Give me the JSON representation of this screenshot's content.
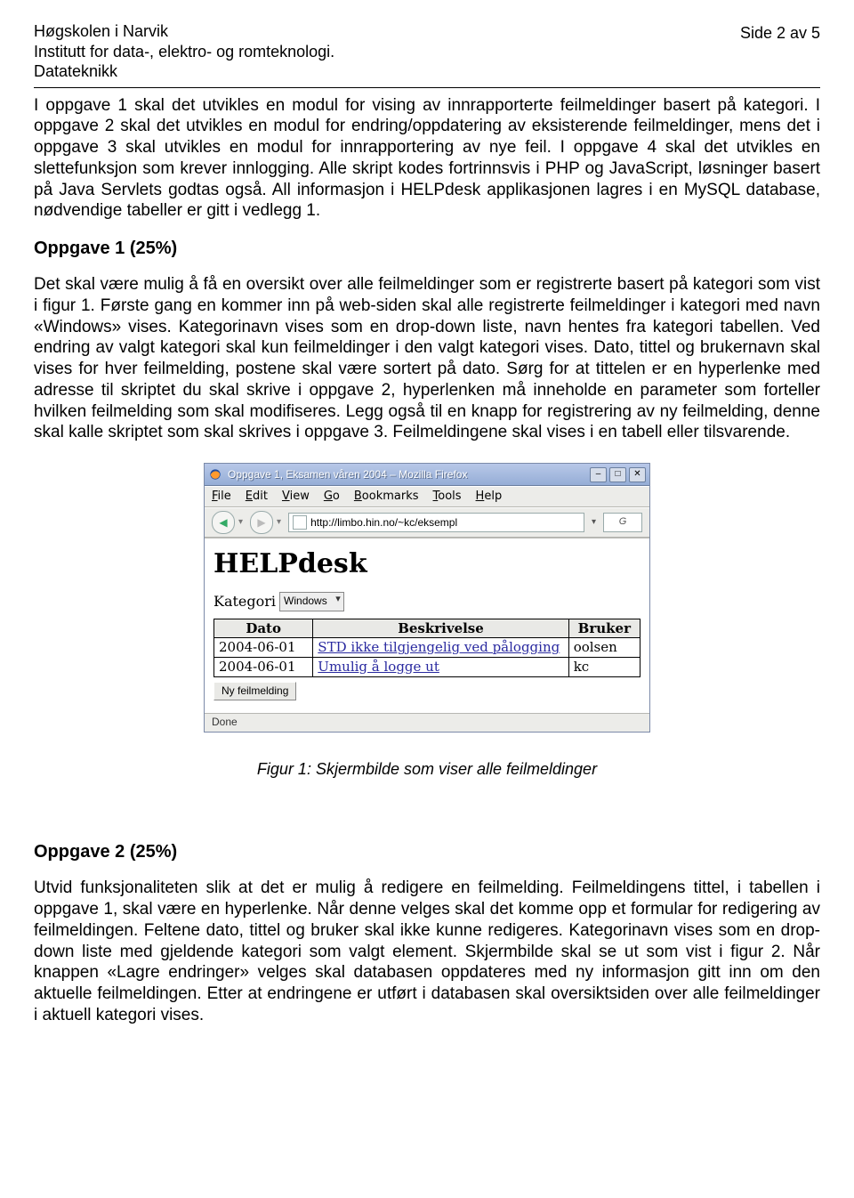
{
  "header": {
    "institution": "Høgskolen i Narvik",
    "department": "Institutt for data-, elektro- og romteknologi.",
    "subject": "Datateknikk",
    "page_num": "Side 2 av 5"
  },
  "intro": "I oppgave 1 skal det utvikles en modul for vising av innrapporterte feilmeldinger basert på kategori. I oppgave 2 skal det utvikles en modul for endring/oppdatering av eksisterende feilmeldinger, mens det i oppgave 3 skal utvikles en modul for innrapportering av nye feil. I oppgave 4 skal det utvikles en slettefunksjon som krever innlogging. Alle skript kodes fortrinnsvis i PHP og JavaScript, løsninger basert på Java Servlets godtas også. All informasjon i HELPdesk applikasjonen lagres i en MySQL database, nødvendige tabeller er gitt i vedlegg 1.",
  "task1": {
    "title": "Oppgave 1 (25%)",
    "body": "Det skal være mulig å få en oversikt over alle feilmeldinger som er registrerte basert på kategori som vist i figur 1. Første gang en kommer inn på web-siden skal alle registrerte feilmeldinger i kategori med navn «Windows» vises. Kategorinavn vises som en drop-down liste, navn hentes fra kategori tabellen. Ved endring av valgt kategori skal kun feilmeldinger i den valgt kategori vises. Dato, tittel og brukernavn skal vises for hver feilmelding, postene skal være sortert på dato. Sørg for at tittelen er en hyperlenke med adresse til skriptet du skal skrive i oppgave 2, hyperlenken må inneholde en parameter som forteller hvilken feilmelding som skal modifiseres. Legg også til en knapp for registrering av ny feilmelding, denne skal kalle skriptet som skal skrives i oppgave 3. Feilmeldingene skal vises i en tabell eller tilsvarende."
  },
  "figure": {
    "window_title": "Oppgave 1, Eksamen våren 2004 – Mozilla Firefox",
    "menus": [
      "File",
      "Edit",
      "View",
      "Go",
      "Bookmarks",
      "Tools",
      "Help"
    ],
    "url": "http://limbo.hin.no/~kc/eksempl",
    "search_hint": "G",
    "app_heading": "HELPdesk",
    "category_label": "Kategori",
    "category_value": "Windows",
    "table": {
      "headers": [
        "Dato",
        "Beskrivelse",
        "Bruker"
      ],
      "rows": [
        {
          "date": "2004-06-01",
          "desc": "STD ikke tilgjengelig ved pålogging",
          "user": "oolsen"
        },
        {
          "date": "2004-06-01",
          "desc": "Umulig å logge ut",
          "user": "kc"
        }
      ]
    },
    "button_new": "Ny feilmelding",
    "status": "Done",
    "caption": "Figur 1: Skjermbilde som viser alle feilmeldinger"
  },
  "task2": {
    "title": "Oppgave 2 (25%)",
    "body": "Utvid funksjonaliteten slik at det er mulig å redigere en feilmelding. Feilmeldingens tittel, i tabellen i oppgave 1, skal være en hyperlenke. Når denne velges skal det komme opp et formular for redigering av feilmeldingen. Feltene dato, tittel og bruker skal ikke kunne redigeres. Kategorinavn vises som en drop-down liste med gjeldende kategori som valgt element. Skjermbilde skal se ut som vist i figur 2. Når knappen «Lagre endringer» velges skal databasen oppdateres med ny informasjon gitt inn om den aktuelle feilmeldingen. Etter at endringene er utført i databasen skal oversiktsiden over alle feilmeldinger i aktuell kategori vises."
  }
}
